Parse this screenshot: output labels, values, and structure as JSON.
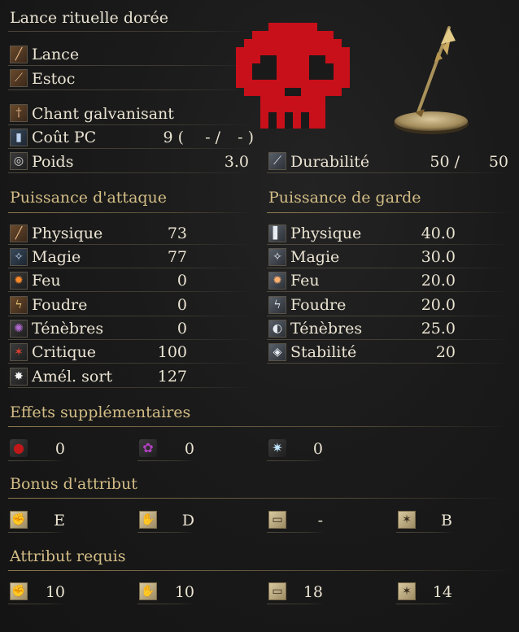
{
  "title": "Lance rituelle dorée",
  "weapon_types": [
    "Lance",
    "Estoc"
  ],
  "skill": "Chant galvanisant",
  "fp_cost": {
    "label": "Coût PC",
    "value": "9 (",
    "mid": "- /",
    "end": "- )"
  },
  "weight": {
    "label": "Poids",
    "value": "3.0"
  },
  "durability": {
    "label": "Durabilité",
    "current": "50 /",
    "max": "50"
  },
  "sections": {
    "attack": "Puissance d'attaque",
    "guard": "Puissance de garde",
    "effects": "Effets supplémentaires",
    "bonus": "Bonus d'attribut",
    "requirements": "Attribut requis"
  },
  "attack": [
    {
      "label": "Physique",
      "value": "73",
      "icon": "physical-attack-icon"
    },
    {
      "label": "Magie",
      "value": "77",
      "icon": "magic-attack-icon"
    },
    {
      "label": "Feu",
      "value": "0",
      "icon": "fire-attack-icon"
    },
    {
      "label": "Foudre",
      "value": "0",
      "icon": "lightning-attack-icon"
    },
    {
      "label": "Ténèbres",
      "value": "0",
      "icon": "dark-attack-icon"
    },
    {
      "label": "Critique",
      "value": "100",
      "icon": "critical-icon"
    },
    {
      "label": "Amél. sort",
      "value": "127",
      "icon": "spell-buff-icon"
    }
  ],
  "guard": [
    {
      "label": "Physique",
      "value": "40.0",
      "icon": "physical-guard-icon"
    },
    {
      "label": "Magie",
      "value": "30.0",
      "icon": "magic-guard-icon"
    },
    {
      "label": "Feu",
      "value": "20.0",
      "icon": "fire-guard-icon"
    },
    {
      "label": "Foudre",
      "value": "20.0",
      "icon": "lightning-guard-icon"
    },
    {
      "label": "Ténèbres",
      "value": "25.0",
      "icon": "dark-guard-icon"
    },
    {
      "label": "Stabilité",
      "value": "20",
      "icon": "stability-icon"
    }
  ],
  "effects": [
    {
      "value": "0",
      "icon": "bleed-icon"
    },
    {
      "value": "0",
      "icon": "poison-icon"
    },
    {
      "value": "0",
      "icon": "frost-icon"
    }
  ],
  "bonus": [
    {
      "value": "E",
      "icon": "strength-icon"
    },
    {
      "value": "D",
      "icon": "dexterity-icon"
    },
    {
      "value": "-",
      "icon": "intelligence-icon"
    },
    {
      "value": "B",
      "icon": "faith-icon"
    }
  ],
  "requirements": [
    {
      "value": "10",
      "icon": "strength-icon"
    },
    {
      "value": "10",
      "icon": "dexterity-icon"
    },
    {
      "value": "18",
      "icon": "intelligence-icon"
    },
    {
      "value": "14",
      "icon": "faith-icon"
    }
  ],
  "colors": {
    "accent": "#d3bd86",
    "text": "#ebe4d3",
    "skull": "#c8101a"
  }
}
